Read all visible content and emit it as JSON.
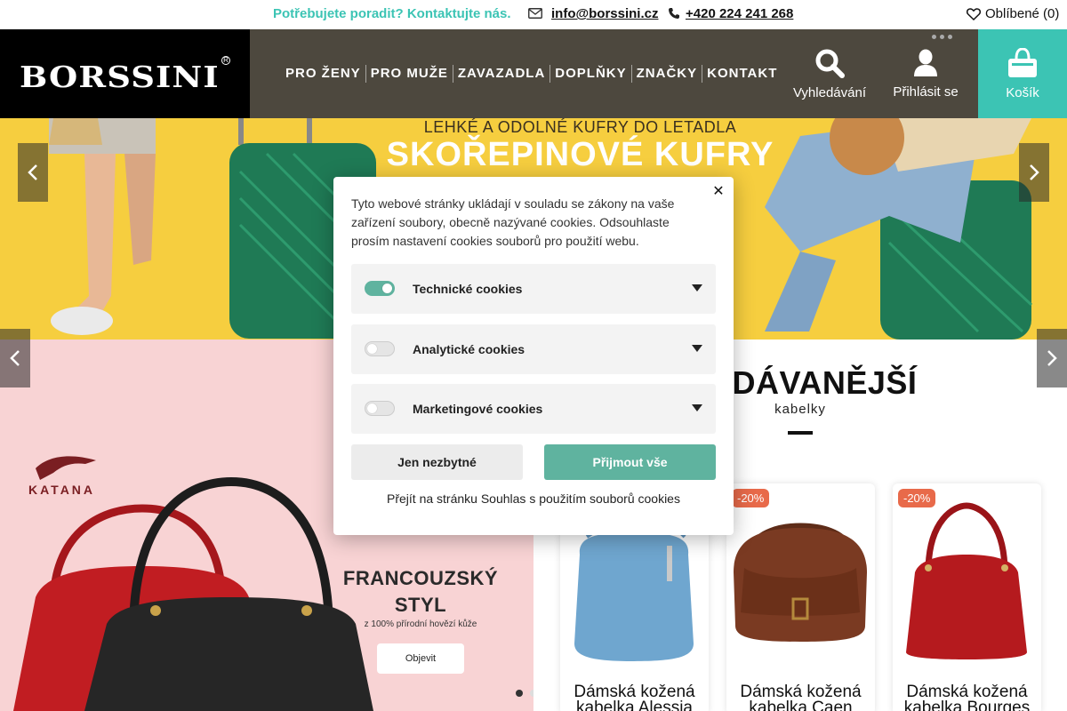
{
  "topbar": {
    "help_text": "Potřebujete poradit?  Kontaktujte nás.",
    "email": "info@borssini.cz",
    "phone": "+420 224 241 268",
    "favorites": "Oblíbené (0)"
  },
  "header": {
    "logo_text": "BORSSINI",
    "logo_mark": "R",
    "nav": [
      "PRO ŽENY",
      "PRO MUŽE",
      "ZAVAZADLA",
      "DOPLŇKY",
      "ZNAČKY",
      "KONTAKT"
    ],
    "search_label": "Vyhledávání",
    "login_label": "Přihlásit se",
    "cart_label": "Košík"
  },
  "banner": {
    "subtitle": "LEHKÉ A ODOLNÉ KUFRY DO LETADLA",
    "title": "SKOŘEPINOVÉ KUFRY"
  },
  "promo": {
    "brand": "KATANA",
    "title_line1": "FRANCOUZSKÝ",
    "title_line2": "STYL",
    "subtitle": "z 100% přírodní hovězí kůže",
    "button": "Objevit"
  },
  "bestsellers": {
    "title": "RODÁVANĚJŠÍ",
    "subtitle": "kabelky",
    "products": [
      {
        "badge": "",
        "name_line1": "Dámská kožená",
        "name_line2": "kabelka Alessia",
        "color": "#6fa6cf"
      },
      {
        "badge": "-20%",
        "name_line1": "Dámská kožená",
        "name_line2": "kabelka Caen",
        "color": "#7a3a22"
      },
      {
        "badge": "-20%",
        "name_line1": "Dámská kožená",
        "name_line2": "kabelka Bourges",
        "color": "#b51a1e"
      }
    ]
  },
  "cookie_modal": {
    "intro": "Tyto webové stránky ukládají v souladu se zákony na vaše zařízení soubory, obecně nazývané cookies. Odsouhlaste prosím nastavení cookies souborů pro použití webu.",
    "rows": [
      {
        "label": "Technické cookies",
        "enabled": true
      },
      {
        "label": "Analytické cookies",
        "enabled": false
      },
      {
        "label": "Marketingové cookies",
        "enabled": false
      }
    ],
    "btn_necessary": "Jen nezbytné",
    "btn_accept": "Přijmout vše",
    "policy_link": "Přejít na stránku Souhlas s použitím souborů cookies",
    "close_symbol": "✕"
  },
  "colors": {
    "accent": "#3cc4b4",
    "accept_button": "#5fb39f",
    "banner_bg": "#f6ce3f",
    "promo_bg": "#f8d3d4",
    "discount_badge": "#e86a4a"
  }
}
